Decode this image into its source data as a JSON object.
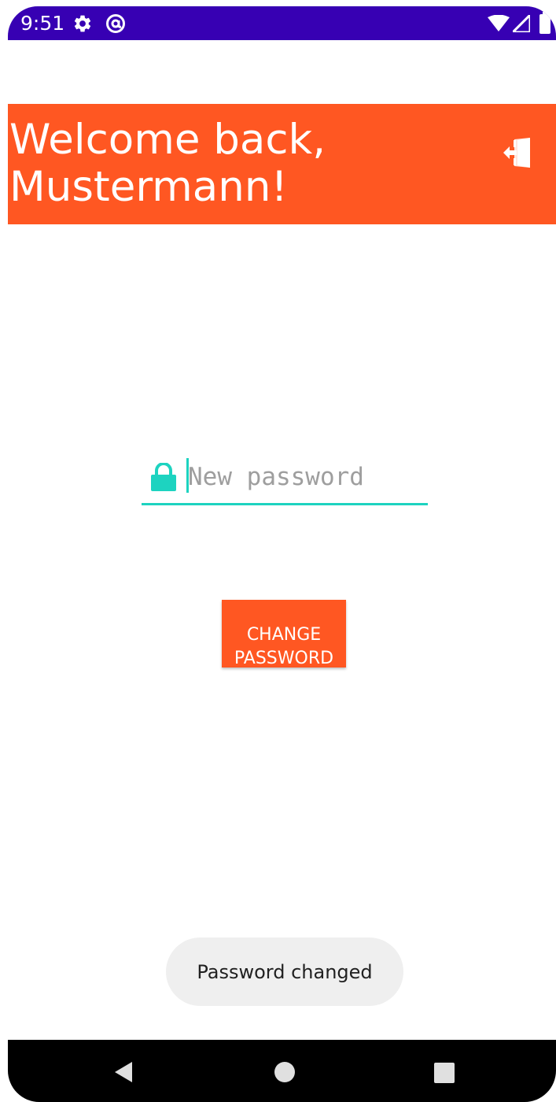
{
  "status_bar": {
    "time": "9:51",
    "icons": [
      "gear-icon",
      "at-sign-icon",
      "wifi-icon",
      "cellular-signal-icon",
      "battery-icon"
    ],
    "background": "#3700b3"
  },
  "header": {
    "title": "Welcome back, Mustermann!",
    "logout_icon": "logout-icon",
    "background": "#ff5722"
  },
  "password_field": {
    "placeholder": "New password",
    "value": "",
    "leading_icon": "lock-icon",
    "accent": "#1dd3c0"
  },
  "change_password_button": {
    "label": "CHANGE PASSWORD",
    "background": "#ff5722"
  },
  "toast": {
    "message": "Password changed"
  },
  "nav_bar": {
    "buttons": [
      "back-icon",
      "home-icon",
      "recents-icon"
    ]
  }
}
